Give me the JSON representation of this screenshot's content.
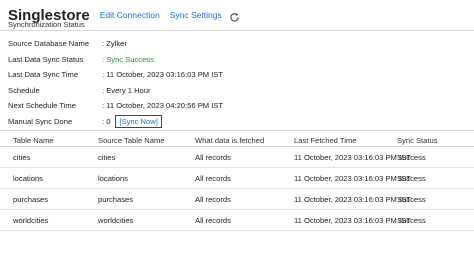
{
  "header": {
    "title": "Singlestore",
    "edit_connection": "Edit Connection",
    "sync_settings": "Sync Settings",
    "subtitle": "Synchronization Status"
  },
  "info": {
    "rows": [
      {
        "label": "Source Database Name",
        "value": ": Zylker"
      },
      {
        "label": "Last Data Sync Status",
        "value": ": Sync Success"
      },
      {
        "label": "Last Data Sync Time",
        "value": ": 11 October, 2023 03:16:03 PM IST"
      },
      {
        "label": "Schedule",
        "value": ": Every 1 Hour"
      },
      {
        "label": "Next Schedule Time",
        "value": ": 11 October, 2023 04:20:56 PM IST"
      },
      {
        "label": "Manual Sync Done",
        "value": ": 0"
      }
    ],
    "sync_now_label": "[Sync Now]",
    "success_color": "#2e8b2e",
    "link_color": "#1a6fd1",
    "highlight_color": "#b01818"
  },
  "table": {
    "headers": [
      "Table Name",
      "Source Table Name",
      "What data is fetched",
      "Last Fetched Time",
      "Sync Status"
    ],
    "rows": [
      [
        "cities",
        "cities",
        "All records",
        "11 October, 2023 03:16:03 PM IST",
        "Success"
      ],
      [
        "locations",
        "locations",
        "All records",
        "11 October, 2023 03:16:03 PM IST",
        "Success"
      ],
      [
        "purchases",
        "purchases",
        "All records",
        "11 October, 2023 03:16:03 PM IST",
        "Success"
      ],
      [
        "worldcities",
        "worldcities",
        "All records",
        "11 October, 2023 03:16:03 PM IST",
        "Success"
      ]
    ]
  }
}
